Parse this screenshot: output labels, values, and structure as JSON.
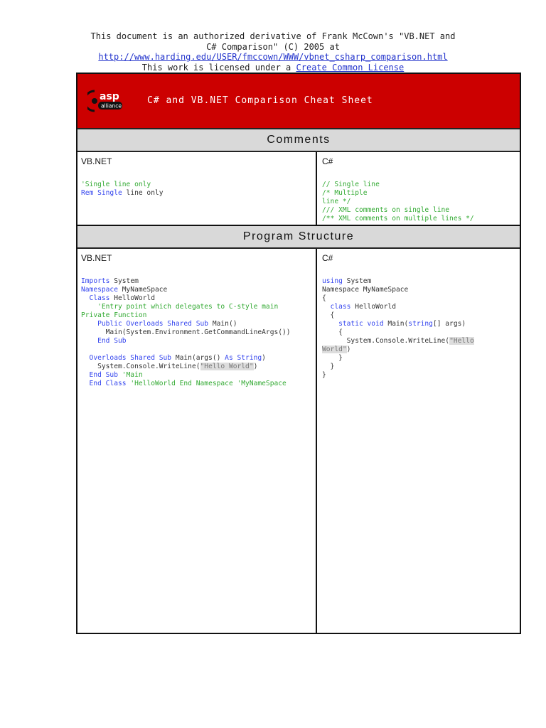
{
  "header": {
    "line1": "This document is an authorized derivative of Frank McCown's \"VB.NET and",
    "line2": "C# Comparison\" (C) 2005 at",
    "link": "http://www.harding.edu/USER/fmccown/WWW/vbnet_csharp_comparison.html",
    "line4_prefix": "This work is licensed under a ",
    "license_link": "Create Common License"
  },
  "banner": {
    "title": "C# and VB.NET Comparison Cheat Sheet",
    "logo_text": "asp",
    "logo_sub": "alliance"
  },
  "sections": [
    {
      "title": "Comments",
      "left_label": "VB.NET",
      "right_label": "C#",
      "left_code": [
        [
          [
            "'Single line only",
            "cm"
          ]
        ],
        [
          [
            "Rem Single",
            "kw"
          ],
          [
            " line only",
            ""
          ]
        ]
      ],
      "right_code": [
        [
          [
            "// Single line",
            "cm"
          ]
        ],
        [
          [
            "/* Multiple",
            "cm"
          ]
        ],
        [
          [
            "line */",
            "cm"
          ]
        ],
        [
          [
            "/// XML comments on single line",
            "cm"
          ]
        ],
        [
          [
            "/** XML comments on multiple lines */",
            "cm"
          ]
        ]
      ]
    },
    {
      "title": "Program Structure",
      "left_label": "VB.NET",
      "right_label": "C#",
      "left_code": [
        [
          [
            "Imports",
            "kw"
          ],
          [
            " System",
            ""
          ]
        ],
        [
          [
            "Namespace",
            "kw"
          ],
          [
            " MyNameSpace",
            ""
          ]
        ],
        [
          [
            "  Class",
            "kw"
          ],
          [
            " HelloWorld",
            ""
          ]
        ],
        [
          [
            "    'Entry point which delegates to C-style main",
            "cm"
          ]
        ],
        [
          [
            "Private Function",
            "cm"
          ]
        ],
        [
          [
            "    Public Overloads Shared Sub",
            "kw"
          ],
          [
            " Main()",
            ""
          ]
        ],
        [
          [
            "      Main(System.Environment.GetCommandLineArgs())",
            ""
          ]
        ],
        [
          [
            "    End Sub",
            "kw"
          ]
        ],
        [
          [
            "",
            ""
          ]
        ],
        [
          [
            "  Overloads Shared Sub",
            "kw"
          ],
          [
            " Main(args() ",
            ""
          ],
          [
            "As String",
            "kw"
          ],
          [
            ")",
            ""
          ]
        ],
        [
          [
            "    System.Console.WriteLine(",
            ""
          ],
          [
            "\"Hello World\"",
            "str"
          ],
          [
            ")",
            ""
          ]
        ],
        [
          [
            "  End Sub",
            "kw"
          ],
          [
            " 'Main",
            "cm"
          ]
        ],
        [
          [
            "  End Class",
            "kw"
          ],
          [
            " 'HelloWorld End Namespace 'MyNameSpace",
            "cm"
          ]
        ]
      ],
      "right_code": [
        [
          [
            "using",
            "kw"
          ],
          [
            " System",
            ""
          ]
        ],
        [
          [
            "Namespace MyNameSpace",
            ""
          ]
        ],
        [
          [
            "{",
            ""
          ]
        ],
        [
          [
            "  class",
            "kw"
          ],
          [
            " HelloWorld",
            ""
          ]
        ],
        [
          [
            "  {",
            ""
          ]
        ],
        [
          [
            "    static void",
            "kw"
          ],
          [
            " Main(",
            ""
          ],
          [
            "string",
            "kw"
          ],
          [
            "[] args)",
            ""
          ]
        ],
        [
          [
            "    {",
            ""
          ]
        ],
        [
          [
            "      System.Console.WriteLine(",
            ""
          ],
          [
            "\"Hello",
            "str"
          ]
        ],
        [
          [
            "World\"",
            "str"
          ],
          [
            ")",
            ""
          ]
        ],
        [
          [
            "    }",
            ""
          ]
        ],
        [
          [
            "  }",
            ""
          ]
        ],
        [
          [
            "}",
            ""
          ]
        ]
      ]
    }
  ]
}
